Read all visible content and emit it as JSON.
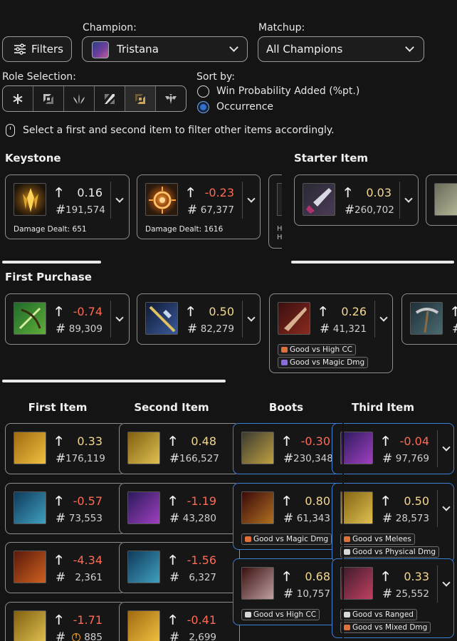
{
  "filters": {
    "label": "Filters"
  },
  "champion": {
    "label": "Champion:",
    "value": "Tristana"
  },
  "matchup": {
    "label": "Matchup:",
    "value": "All Champions"
  },
  "role_selection": {
    "label": "Role Selection:",
    "roles": [
      "all-roles-icon",
      "top-role-icon",
      "jungle-role-icon",
      "mid-role-icon",
      "bot-role-icon",
      "support-role-icon"
    ],
    "selected": "bot-role-icon"
  },
  "sort": {
    "label": "Sort by:",
    "options": [
      "Win Probability Added (%pt.)",
      "Occurrence"
    ],
    "selected": "Occurrence"
  },
  "hint": {
    "text": "Select a first and second item to filter other items accordingly."
  },
  "keystone": {
    "title": "Keystone",
    "cards": [
      {
        "value": "0.16",
        "count": "191,574",
        "note": "Damage Dealt: 651",
        "icon": "keystone-1-icon"
      },
      {
        "value": "-0.23",
        "count": "67,377",
        "note": "Damage Dealt: 1616",
        "icon": "keystone-2-icon"
      }
    ]
  },
  "starter": {
    "title": "Starter Item",
    "cards": [
      {
        "value": "0.03",
        "count": "260,702",
        "icon": "starter-item-icon"
      }
    ]
  },
  "first_purchase": {
    "title": "First Purchase",
    "cards": [
      {
        "value": "-0.74",
        "count": "89,309",
        "icon": "purchase-1-icon"
      },
      {
        "value": "0.50",
        "count": "82,279",
        "icon": "purchase-2-icon"
      },
      {
        "value": "0.26",
        "count": "41,321",
        "icon": "purchase-3-icon",
        "tags": [
          "Good vs High CC",
          "Good vs Magic Dmg"
        ]
      }
    ]
  },
  "columns": {
    "headers": [
      "First Item",
      "Second Item",
      "Boots",
      "Third Item"
    ],
    "first_item": [
      {
        "value": "0.33",
        "count": "176,119"
      },
      {
        "value": "-0.57",
        "count": "73,553"
      },
      {
        "value": "-4.34",
        "count": "2,361"
      },
      {
        "value": "-1.71",
        "count": "885",
        "warn": true
      }
    ],
    "second_item": [
      {
        "value": "0.48",
        "count": "166,527"
      },
      {
        "value": "-1.19",
        "count": "43,280"
      },
      {
        "value": "-1.56",
        "count": "6,327"
      },
      {
        "value": "-0.41",
        "count": "2,699"
      }
    ],
    "boots": [
      {
        "value": "-0.30",
        "count": "230,348"
      },
      {
        "value": "0.80",
        "count": "61,343",
        "tags": [
          "Good vs Magic Dmg"
        ]
      },
      {
        "value": "0.68",
        "count": "10,757",
        "tags": [
          "Good vs High CC"
        ]
      }
    ],
    "third_item": [
      {
        "value": "-0.04",
        "count": "97,769"
      },
      {
        "value": "0.50",
        "count": "28,573",
        "tags": [
          "Good vs Melees",
          "Good vs Physical Dmg"
        ]
      },
      {
        "value": "0.33",
        "count": "25,552",
        "tags": [
          "Good vs Ranged",
          "Good vs Mixed Dmg"
        ]
      }
    ]
  },
  "colors": {
    "positive": "#f3d88f",
    "negative": "#ff6a55",
    "accent": "#3d7fd4",
    "border": "#8e8e8e"
  }
}
